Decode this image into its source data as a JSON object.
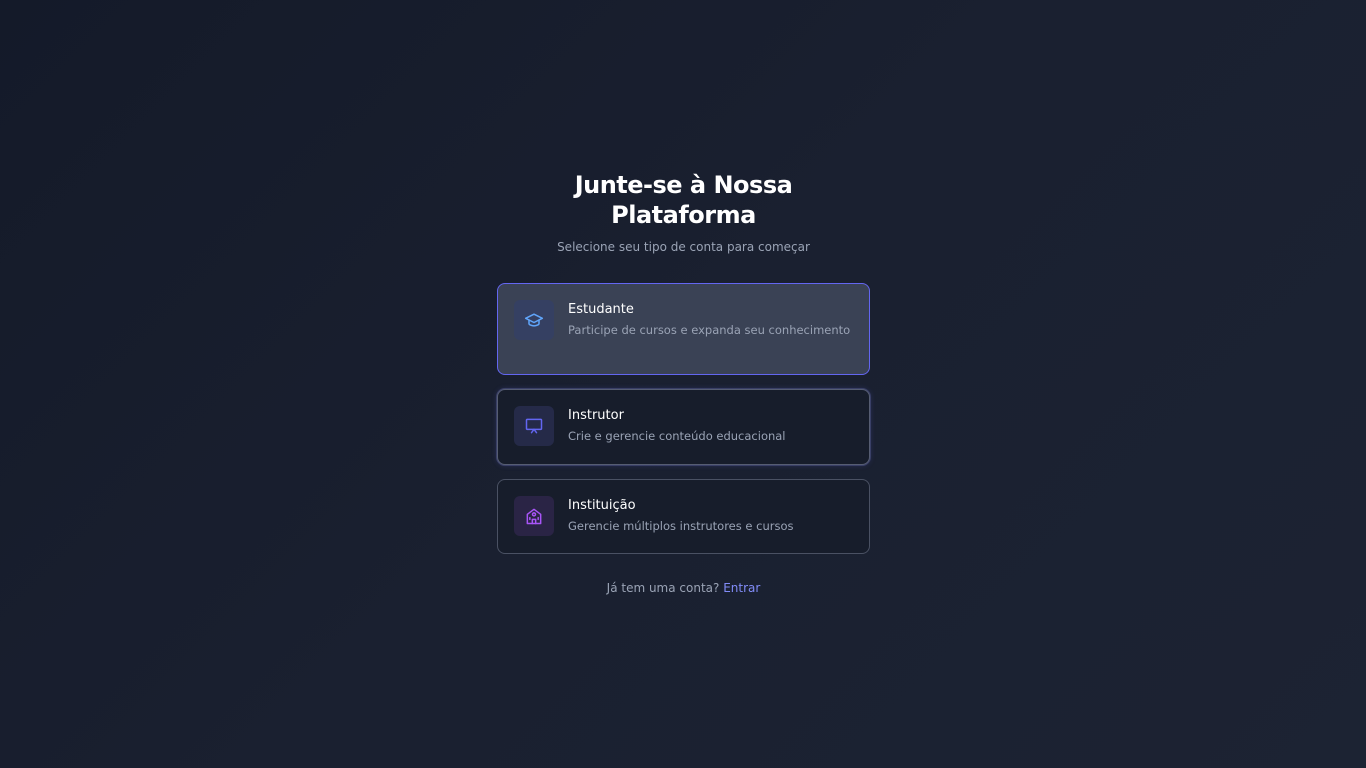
{
  "header": {
    "title": "Junte-se à Nossa Plataforma",
    "subtitle": "Selecione seu tipo de conta para começar"
  },
  "account_types": [
    {
      "title": "Estudante",
      "description": "Participe de cursos e expanda seu conhecimento",
      "icon": "graduation-cap-icon",
      "icon_color": "#60a5fa",
      "state": "selected"
    },
    {
      "title": "Instrutor",
      "description": "Crie e gerencie conteúdo educacional",
      "icon": "presentation-board-icon",
      "icon_color": "#6366f1",
      "state": "focused"
    },
    {
      "title": "Instituição",
      "description": "Gerencie múltiplos instrutores e cursos",
      "icon": "school-building-icon",
      "icon_color": "#a855f7",
      "state": "default"
    }
  ],
  "footer": {
    "prompt": "Já tem uma conta?",
    "login_link": "Entrar"
  },
  "colors": {
    "accent": "#6366f1",
    "link": "#818cf8",
    "background": "#171d2b"
  }
}
